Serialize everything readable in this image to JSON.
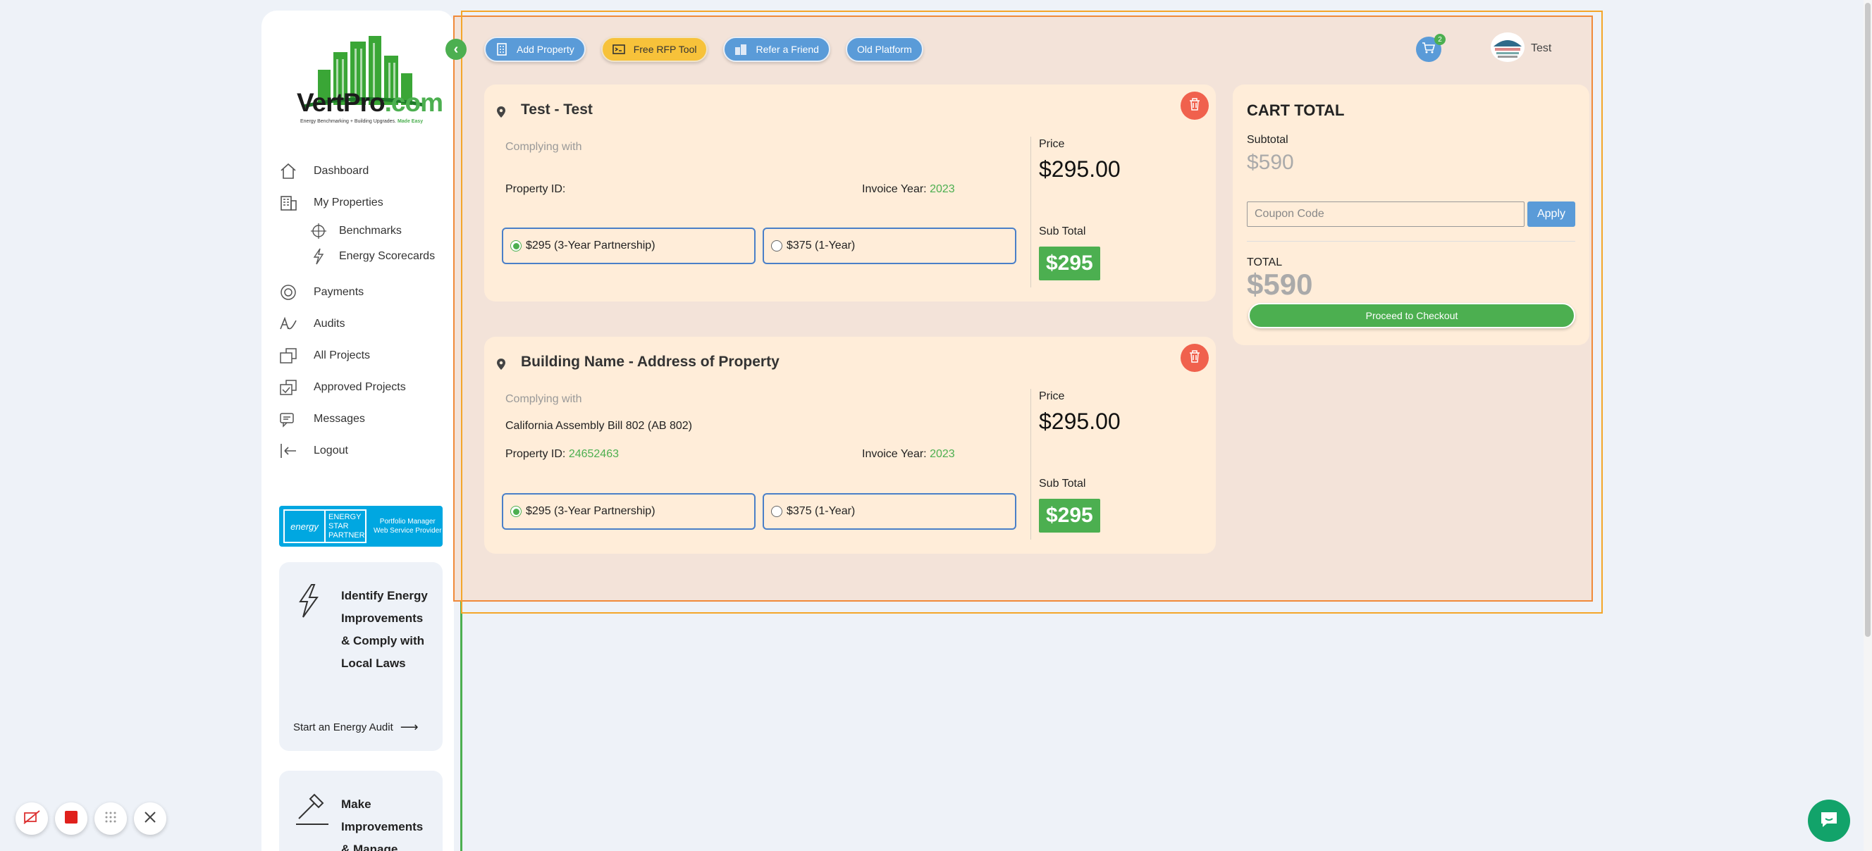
{
  "sidebar": {
    "logo": {
      "brand": "VertPro",
      "domain": ".com",
      "tagline": "Energy Benchmarking + Building Upgrades.",
      "tagline_accent": "Made Easy"
    },
    "nav": [
      {
        "label": "Dashboard",
        "icon": "home-icon"
      },
      {
        "label": "My Properties",
        "icon": "building-icon"
      }
    ],
    "sub_nav": [
      {
        "label": "Benchmarks",
        "icon": "crosshair-icon"
      },
      {
        "label": "Energy Scorecards",
        "icon": "lightning-icon"
      }
    ],
    "nav2": [
      {
        "label": "Payments",
        "icon": "payments-icon"
      },
      {
        "label": "Audits",
        "icon": "audits-icon"
      },
      {
        "label": "All Projects",
        "icon": "projects-icon"
      },
      {
        "label": "Approved Projects",
        "icon": "approved-icon"
      },
      {
        "label": "Messages",
        "icon": "messages-icon"
      },
      {
        "label": "Logout",
        "icon": "logout-icon"
      }
    ],
    "energy_star": {
      "logo": "energy",
      "line1": "ENERGY",
      "line2": "STAR",
      "line3": "PARTNER",
      "right1": "Portfolio Manager",
      "right2": "Web Service Provider"
    },
    "promo1": {
      "title": "Identify Energy Improvements & Comply with Local Laws",
      "link": "Start an Energy Audit"
    },
    "promo2": {
      "title": "Make Improvements & Manage Projects"
    }
  },
  "topbar": {
    "buttons": [
      "Add Property",
      "Free RFP Tool",
      "Refer a Friend",
      "Old Platform"
    ],
    "cart_count": "2",
    "user": "Test"
  },
  "cards": [
    {
      "title": "Test - Test",
      "complying_label": "Complying with",
      "complying_value": "",
      "property_id_label": "Property ID:",
      "property_id": "",
      "invoice_year_label": "Invoice Year:",
      "invoice_year": "2023",
      "option1": "$295 (3-Year Partnership)",
      "option2": "$375 (1-Year)",
      "price_label": "Price",
      "price": "$295.00",
      "subtotal_label": "Sub Total",
      "subtotal": "$295"
    },
    {
      "title": "Building Name - Address of Property",
      "complying_label": "Complying with",
      "complying_value": "California Assembly Bill 802 (AB 802)",
      "property_id_label": "Property ID:",
      "property_id": "24652463",
      "invoice_year_label": "Invoice Year:",
      "invoice_year": "2023",
      "option1": "$295 (3-Year Partnership)",
      "option2": "$375 (1-Year)",
      "price_label": "Price",
      "price": "$295.00",
      "subtotal_label": "Sub Total",
      "subtotal": "$295"
    }
  ],
  "cart": {
    "title": "CART TOTAL",
    "subtotal_label": "Subtotal",
    "subtotal": "$590",
    "coupon_placeholder": "Coupon Code",
    "apply": "Apply",
    "total_label": "TOTAL",
    "total": "$590",
    "checkout": "Proceed to Checkout"
  },
  "colors": {
    "accent_green": "#4caf50",
    "accent_blue": "#5a9bd8",
    "danger": "#f0614d",
    "card_bg": "#ffedd9"
  }
}
